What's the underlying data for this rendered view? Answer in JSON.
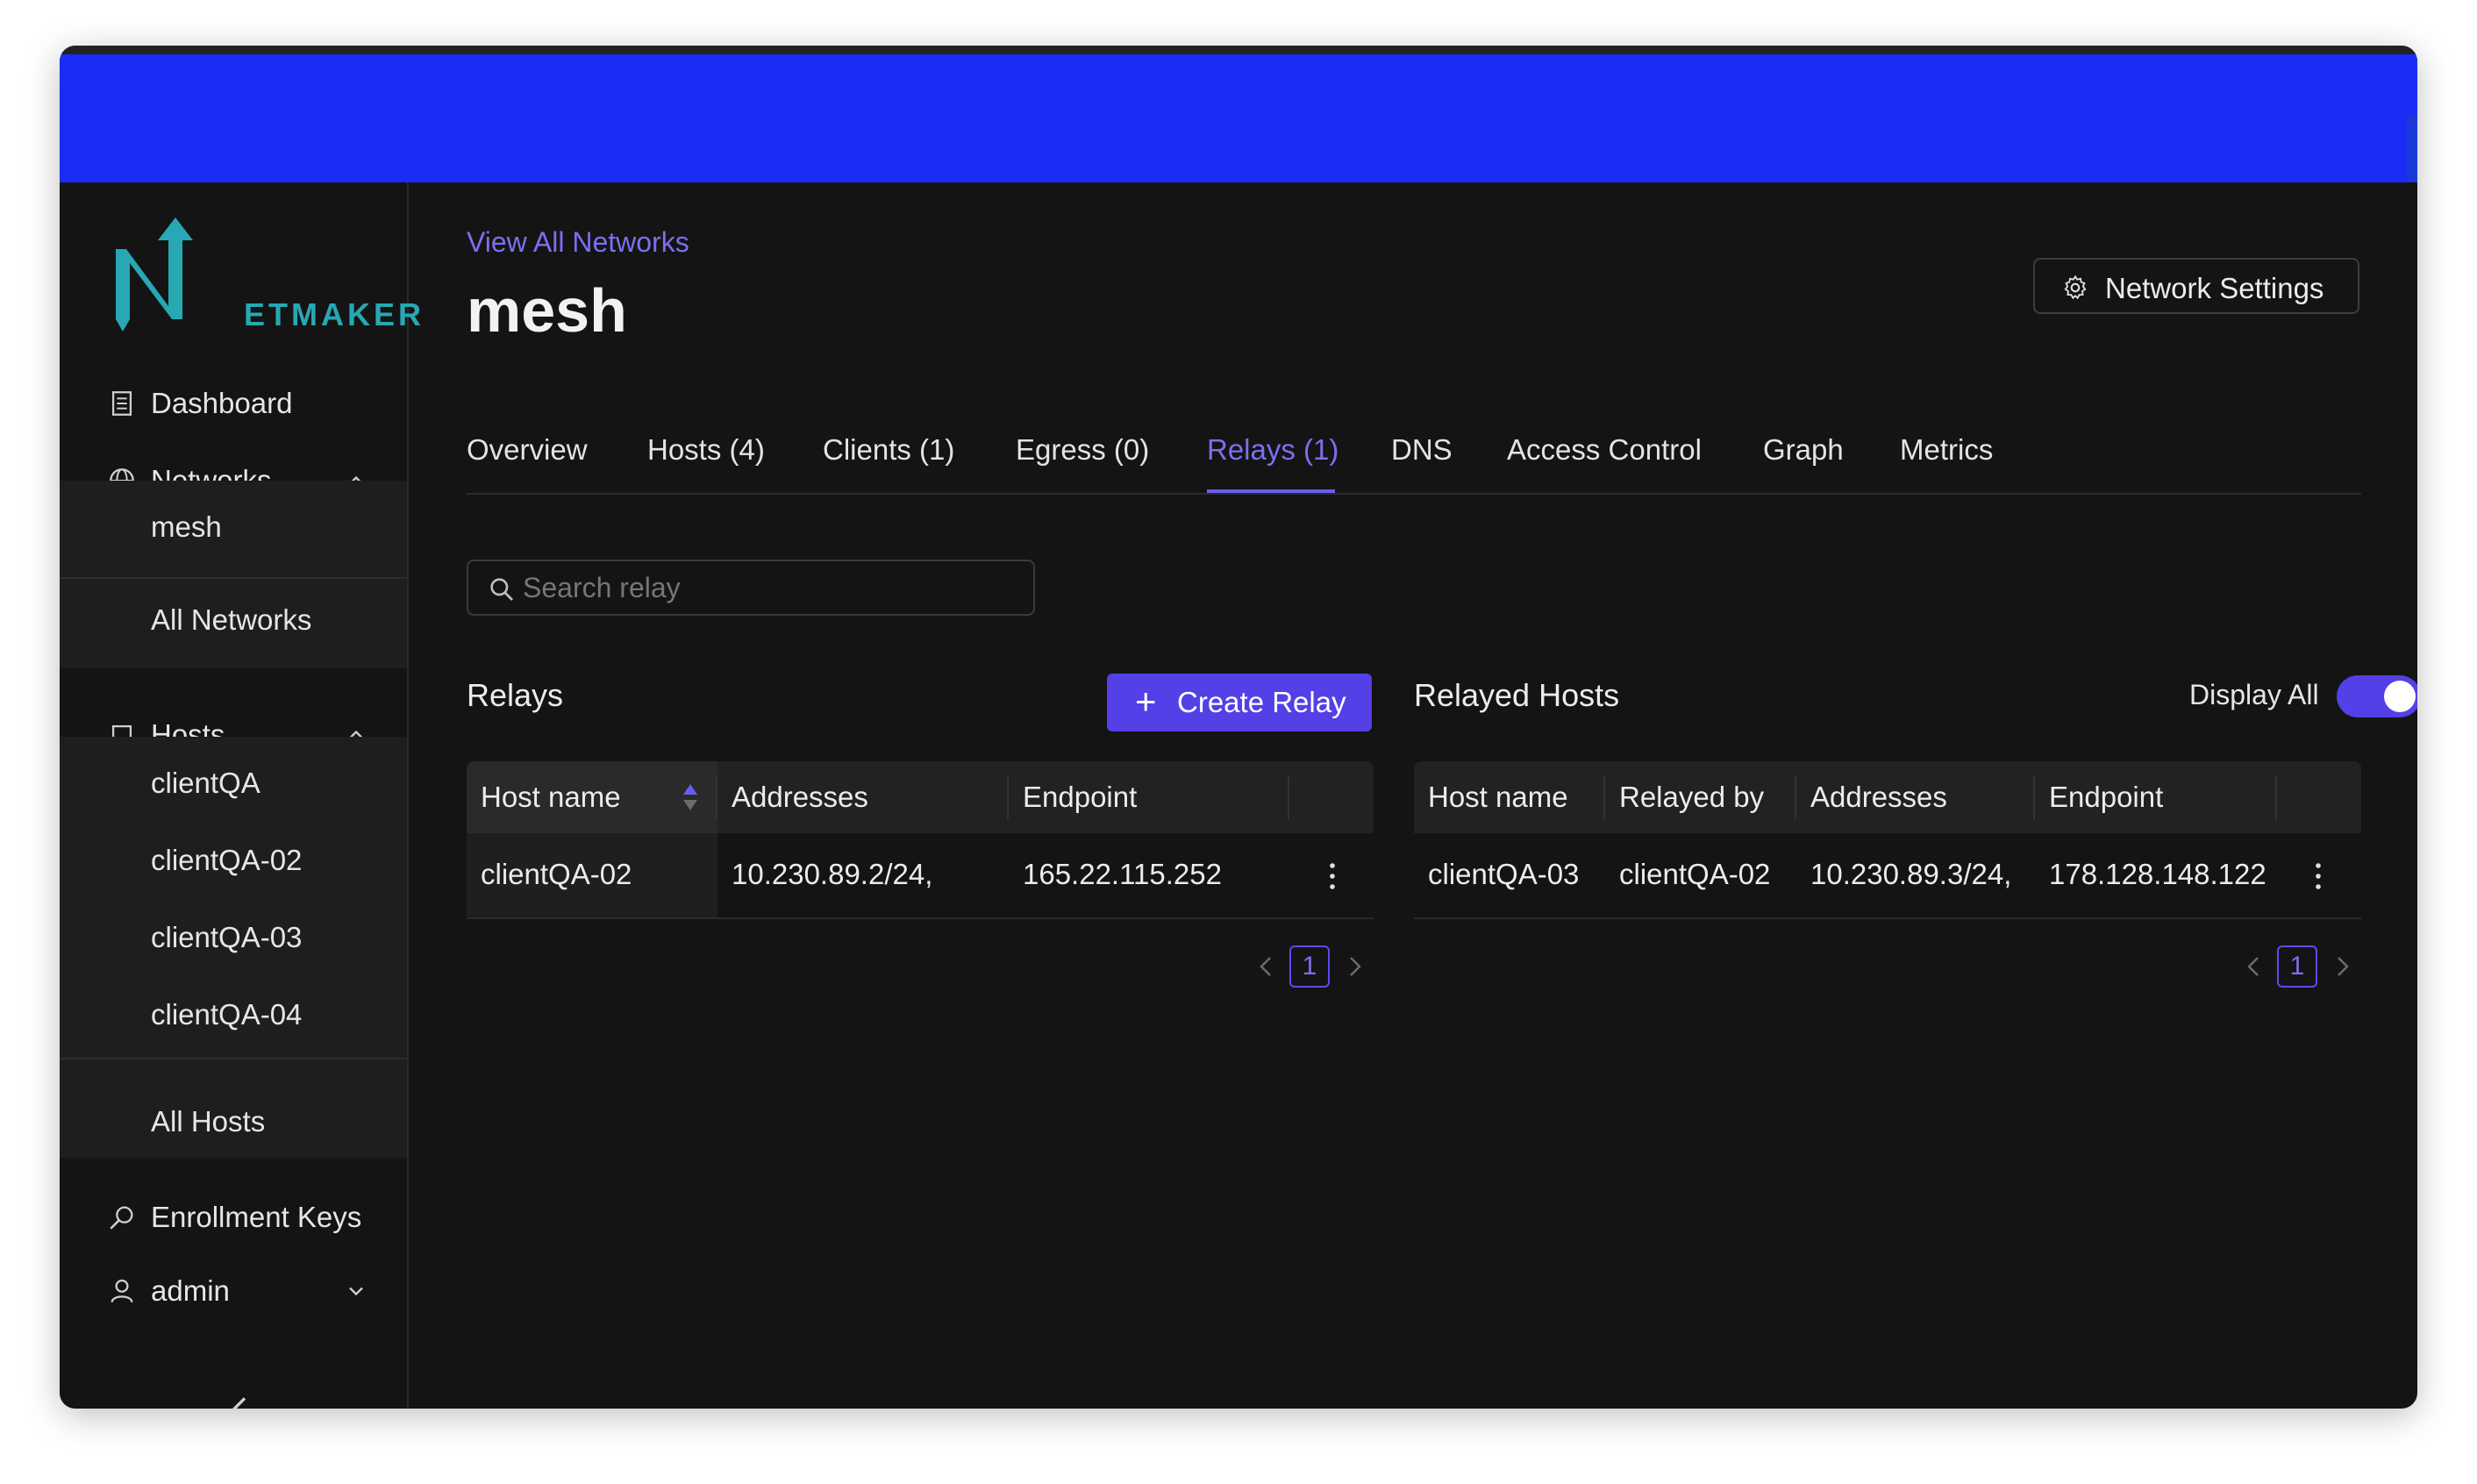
{
  "brand": {
    "logo_letter": "N",
    "logo_text": "ETMAKER"
  },
  "sidebar": {
    "dashboard": "Dashboard",
    "networks": "Networks",
    "network_items": [
      "mesh",
      "All Networks"
    ],
    "hosts": "Hosts",
    "host_items": [
      "clientQA",
      "clientQA-02",
      "clientQA-03",
      "clientQA-04",
      "All Hosts"
    ],
    "enrollment_keys": "Enrollment Keys",
    "user": "admin"
  },
  "header": {
    "view_all": "View All Networks",
    "title": "mesh",
    "settings_label": "Network Settings"
  },
  "tabs": [
    {
      "label": "Overview"
    },
    {
      "label": "Hosts (4)"
    },
    {
      "label": "Clients (1)"
    },
    {
      "label": "Egress (0)"
    },
    {
      "label": "Relays (1)",
      "active": true
    },
    {
      "label": "DNS"
    },
    {
      "label": "Access Control"
    },
    {
      "label": "Graph"
    },
    {
      "label": "Metrics"
    }
  ],
  "search": {
    "placeholder": "Search relay"
  },
  "relays": {
    "title": "Relays",
    "create_label": "Create Relay",
    "columns": [
      "Host name",
      "Addresses",
      "Endpoint"
    ],
    "rows": [
      {
        "host": "clientQA-02",
        "addresses": "10.230.89.2/24,",
        "endpoint": "165.22.115.252"
      }
    ],
    "page": "1"
  },
  "relayed_hosts": {
    "title": "Relayed Hosts",
    "display_all_label": "Display All",
    "display_all_on": true,
    "columns": [
      "Host name",
      "Relayed by",
      "Addresses",
      "Endpoint"
    ],
    "rows": [
      {
        "host": "clientQA-03",
        "relayed_by": "clientQA-02",
        "addresses": "10.230.89.3/24,",
        "endpoint": "178.128.148.122"
      }
    ],
    "page": "1"
  },
  "colors": {
    "accent": "#5340e6",
    "link": "#7c6ff0",
    "topbar": "#1a2cf6",
    "logo": "#27a8b3",
    "background": "#141414"
  }
}
